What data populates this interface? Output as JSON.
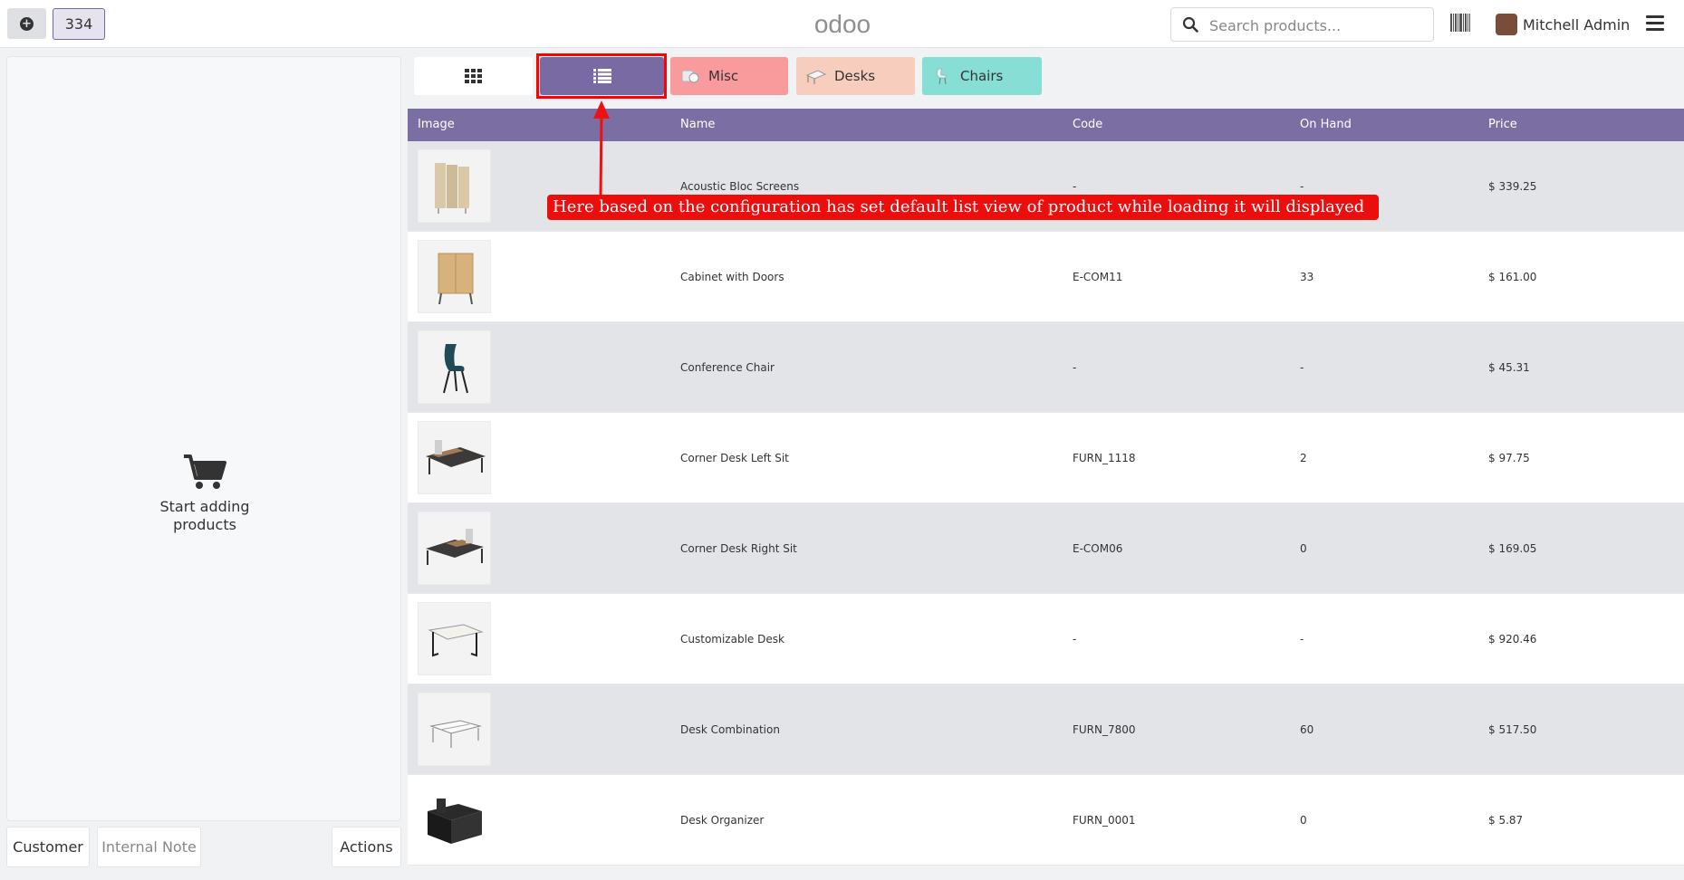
{
  "header": {
    "order_number": "334",
    "logo_text": "odoo",
    "search_placeholder": "Search products...",
    "user_name": "Mitchell Admin"
  },
  "left_panel": {
    "empty_text_line1": "Start adding",
    "empty_text_line2": "products",
    "customer_label": "Customer",
    "note_label": "Internal Note",
    "actions_label": "Actions"
  },
  "categories": {
    "misc": "Misc",
    "desks": "Desks",
    "chairs": "Chairs"
  },
  "colors": {
    "accent": "#7b6ea3",
    "misc": "#f99b9c",
    "desks": "#f7cdbd",
    "chairs": "#87ded5",
    "annotation": "#ec0d0d"
  },
  "table": {
    "headers": {
      "image": "Image",
      "name": "Name",
      "code": "Code",
      "on_hand": "On Hand",
      "price": "Price"
    },
    "rows": [
      {
        "name": "Acoustic Bloc Screens",
        "code": "-",
        "on_hand": "-",
        "price": "$ 339.25"
      },
      {
        "name": "Cabinet with Doors",
        "code": "E-COM11",
        "on_hand": "33",
        "price": "$ 161.00"
      },
      {
        "name": "Conference Chair",
        "code": "-",
        "on_hand": "-",
        "price": "$ 45.31"
      },
      {
        "name": "Corner Desk Left Sit",
        "code": "FURN_1118",
        "on_hand": "2",
        "price": "$ 97.75"
      },
      {
        "name": "Corner Desk Right Sit",
        "code": "E-COM06",
        "on_hand": "0",
        "price": "$ 169.05"
      },
      {
        "name": "Customizable Desk",
        "code": "-",
        "on_hand": "-",
        "price": "$ 920.46"
      },
      {
        "name": "Desk Combination",
        "code": "FURN_7800",
        "on_hand": "60",
        "price": "$ 517.50"
      },
      {
        "name": "Desk Organizer",
        "code": "FURN_0001",
        "on_hand": "0",
        "price": "$ 5.87"
      }
    ]
  },
  "annotation": {
    "text": "Here based on the configuration has set default list view of product while loading it will displayed"
  }
}
